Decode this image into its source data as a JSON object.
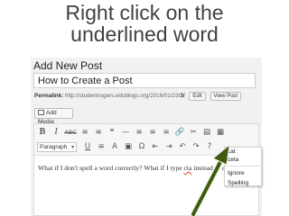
{
  "slide": {
    "title_line1": "Right click on the",
    "title_line2": "underlined word"
  },
  "editor": {
    "heading": "Add New Post",
    "post_title": "How to Create a Post",
    "permalink_label": "Permalink:",
    "permalink_url": "http://studentrogers.edublogs.org/2016/01/23/",
    "permalink_slug": "3/",
    "edit_label": "Edit",
    "view_post_label": "View Post",
    "add_media_label": "Add Media",
    "format_select": "Paragraph"
  },
  "toolbar": {
    "row1": [
      "B",
      "I",
      "ABC",
      "≡",
      "≡",
      "❝",
      "—",
      "≡",
      "≡",
      "≡",
      "🔗",
      "✂",
      "▤",
      "▦"
    ],
    "row2": [
      "U",
      "≡",
      "A",
      "▣",
      "Ω",
      "⇤",
      "⇥",
      "↶",
      "↷",
      "?"
    ]
  },
  "content": {
    "before": "What if I don't spell a word correctly?  What if I type ",
    "misspelled": "cta",
    "after": " instead of cat?"
  },
  "context_menu": {
    "suggestions": [
      "cat",
      "ceta"
    ],
    "ignore_label": "Ignore Spelling"
  },
  "colors": {
    "arrow": "#3f5a0f",
    "spell_underline": "#d54e21"
  }
}
